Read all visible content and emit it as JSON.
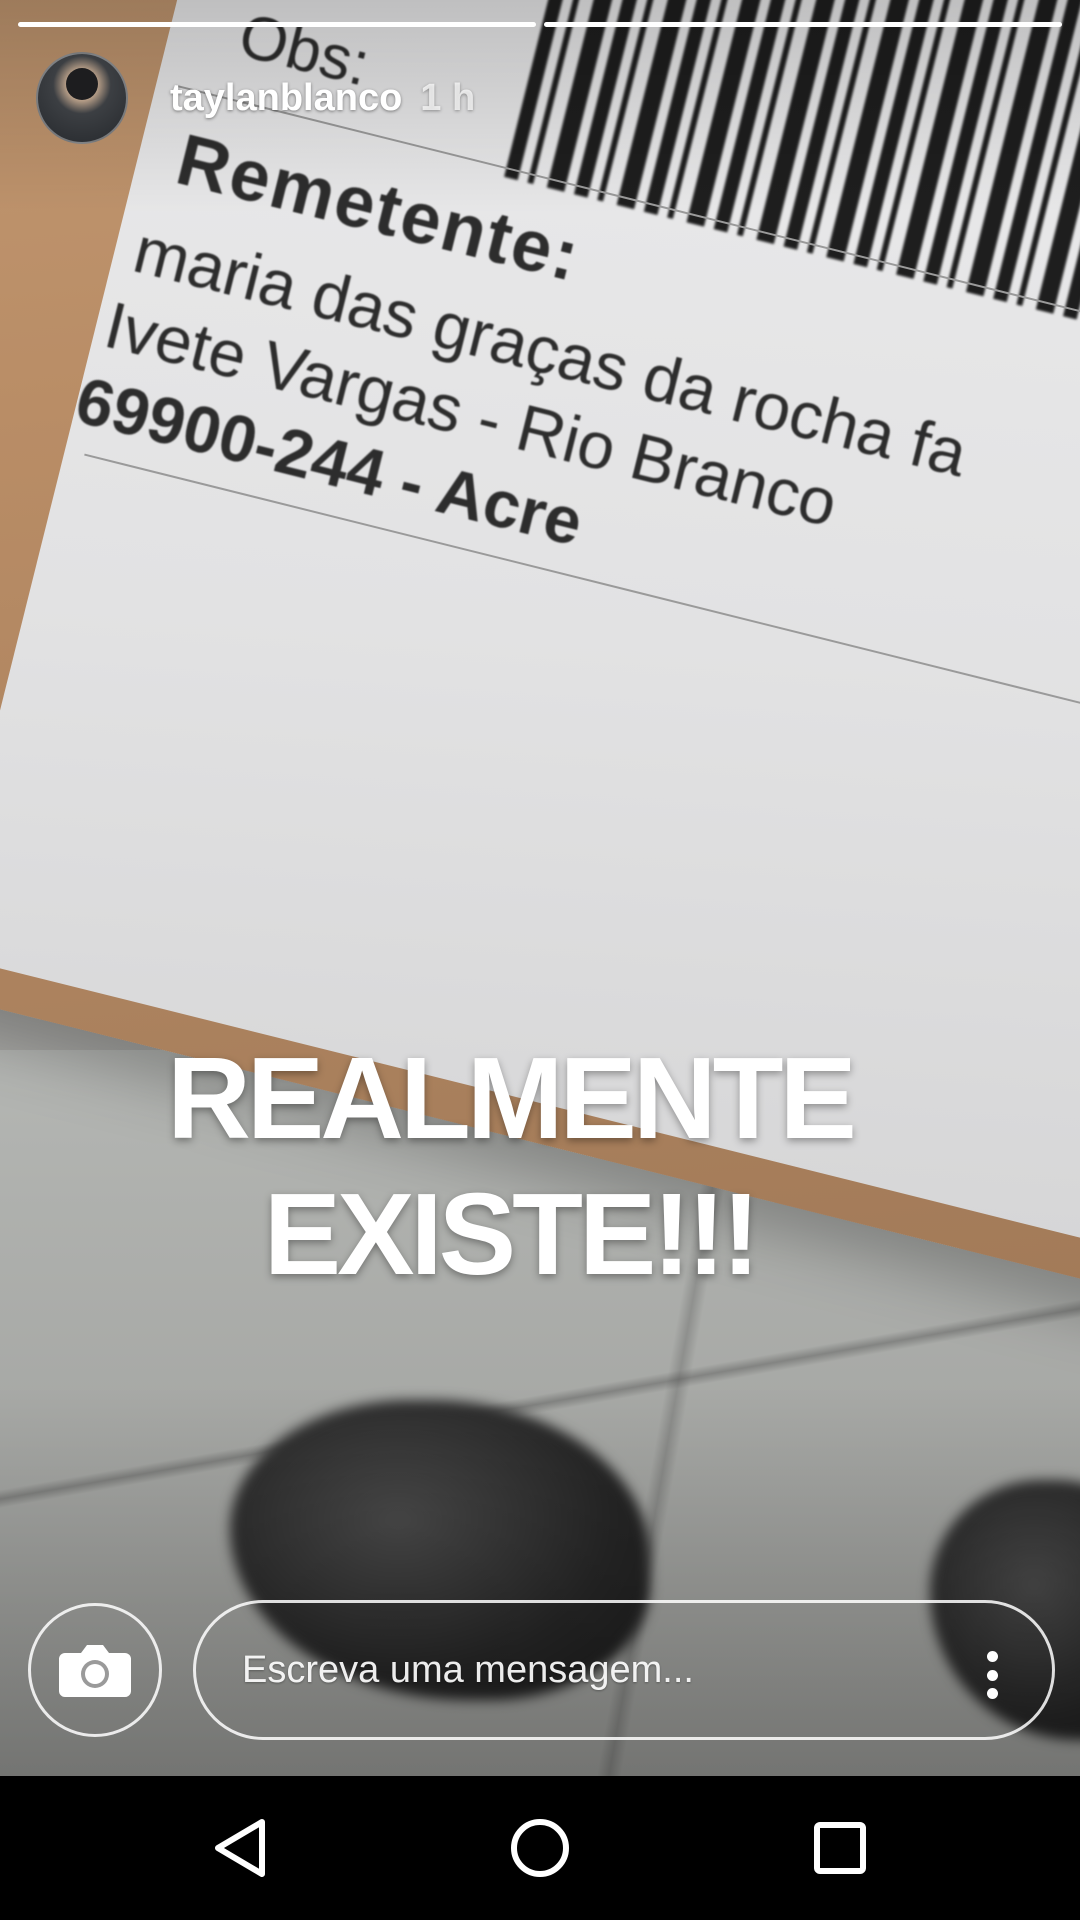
{
  "story": {
    "progress": [
      1.0,
      1.0
    ]
  },
  "header": {
    "username": "taylanblanco",
    "timestamp": "1 h"
  },
  "photo_label": {
    "obs": "Obs:",
    "remetente": "Remetente:",
    "line1": "maria das graças da rocha fa",
    "line2": "Ivete Vargas - Rio Branco",
    "line3": "69900-244 - Acre"
  },
  "caption": {
    "line1": "REALMENTE",
    "line2": "EXISTE!!!"
  },
  "reply": {
    "camera_icon": "camera-icon",
    "placeholder": "Escreva uma mensagem...",
    "more_icon": "more-vertical-icon"
  },
  "navbar": {
    "back_icon": "back-triangle-icon",
    "home_icon": "home-circle-icon",
    "recents_icon": "recents-square-icon"
  }
}
